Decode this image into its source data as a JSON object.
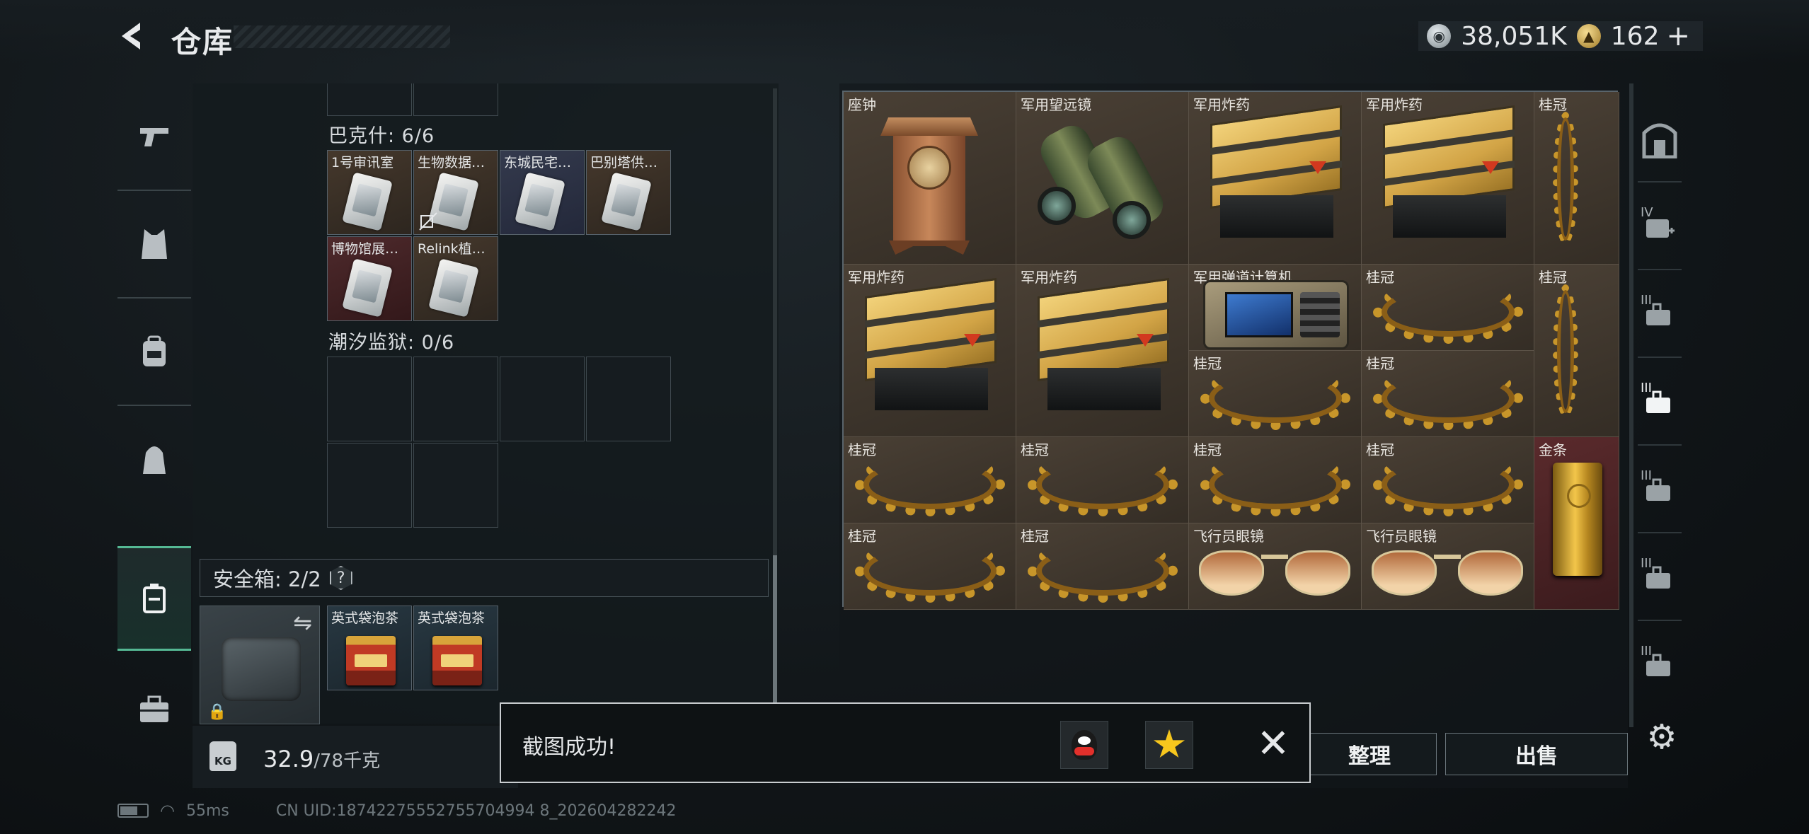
{
  "header": {
    "title": "仓库",
    "currency": {
      "coins": "38,051K",
      "gems": "162",
      "plus": "+"
    }
  },
  "left_nav": [
    {
      "name": "weapons",
      "icon": "pistol-icon"
    },
    {
      "name": "armor",
      "icon": "vest-icon"
    },
    {
      "name": "backpack",
      "icon": "backpack-icon"
    },
    {
      "name": "bag",
      "icon": "bag-icon"
    },
    {
      "name": "safebox",
      "icon": "safebox-icon",
      "active": true
    },
    {
      "name": "toolbox",
      "icon": "briefcase-icon"
    }
  ],
  "inventory": {
    "sections": [
      {
        "label": "巴克什: 6/6",
        "slots": [
          {
            "label": "1号审讯室",
            "tone": "brown"
          },
          {
            "label": "生物数据…",
            "tone": "brown"
          },
          {
            "label": "东城民宅…",
            "tone": "blue"
          },
          {
            "label": "巴别塔供…",
            "tone": "brown"
          },
          {
            "label": "博物馆展…",
            "tone": "red"
          },
          {
            "label": "Relink植…",
            "tone": "brown"
          }
        ]
      },
      {
        "label": "潮汐监狱: 0/6"
      }
    ],
    "safebox": {
      "label": "安全箱: 2/2",
      "help": "?",
      "items": [
        {
          "label": "英式袋泡茶"
        },
        {
          "label": "英式袋泡茶"
        }
      ]
    },
    "weight": {
      "current": "32.9",
      "max": "/78千克",
      "icon_text": "KG"
    }
  },
  "storage_grid": {
    "items": [
      {
        "label": "座钟",
        "kind": "clock"
      },
      {
        "label": "军用望远镜",
        "kind": "binoculars"
      },
      {
        "label": "军用炸药",
        "kind": "crate"
      },
      {
        "label": "军用炸药",
        "kind": "crate"
      },
      {
        "label": "桂冠",
        "kind": "laurel-vertical"
      },
      {
        "label": "军用炸药",
        "kind": "crate"
      },
      {
        "label": "军用炸药",
        "kind": "crate"
      },
      {
        "label": "军用弹道计算机",
        "kind": "computer"
      },
      {
        "label": "桂冠",
        "kind": "laurel"
      },
      {
        "label": "桂冠",
        "kind": "laurel-vertical"
      },
      {
        "label": "桂冠",
        "kind": "laurel"
      },
      {
        "label": "桂冠",
        "kind": "laurel"
      },
      {
        "label": "桂冠",
        "kind": "laurel"
      },
      {
        "label": "桂冠",
        "kind": "laurel"
      },
      {
        "label": "桂冠",
        "kind": "laurel"
      },
      {
        "label": "桂冠",
        "kind": "laurel"
      },
      {
        "label": "金条",
        "kind": "gold-bar"
      },
      {
        "label": "桂冠",
        "kind": "laurel"
      },
      {
        "label": "桂冠",
        "kind": "laurel"
      },
      {
        "label": "飞行员眼镜",
        "kind": "sunglasses"
      },
      {
        "label": "飞行员眼镜",
        "kind": "sunglasses"
      }
    ]
  },
  "right_nav": [
    {
      "icon": "fortress-icon"
    },
    {
      "icon": "medkit-icon",
      "tier": "IV"
    },
    {
      "icon": "ammo-icon",
      "tier": "III"
    },
    {
      "icon": "ammo-icon",
      "tier": "III",
      "active": true
    },
    {
      "icon": "ammo-icon",
      "tier": "III"
    },
    {
      "icon": "ammo-icon",
      "tier": "III"
    },
    {
      "icon": "ammo-icon",
      "tier": "III"
    }
  ],
  "actions": {
    "sort": "整理",
    "sell": "出售"
  },
  "toast": {
    "message": "截图成功!"
  },
  "status_bar": {
    "ping": "55ms",
    "uid": "CN UID:18742275552755704994 8_202604282242"
  }
}
